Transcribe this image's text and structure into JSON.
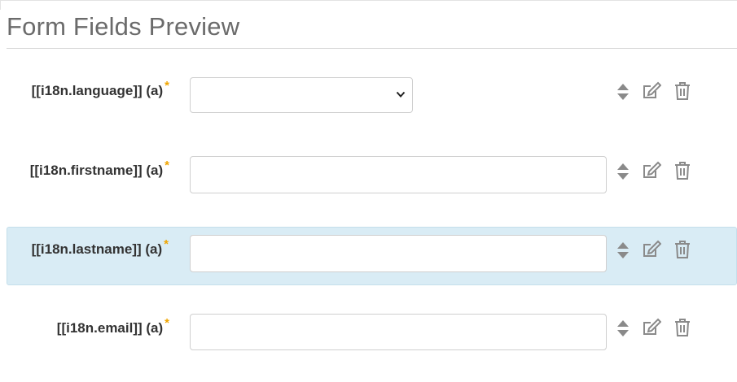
{
  "page": {
    "title": "Form Fields Preview"
  },
  "colors": {
    "required_marker": "#f0a500",
    "highlight_row": "#d9ecf5",
    "icon": "#8a8a8a"
  },
  "fields": [
    {
      "label": "[[i18n.language]] (a)",
      "required_marker": "*",
      "type": "select",
      "value": "",
      "icons": [
        "sort-icon",
        "edit-icon",
        "trash-icon"
      ]
    },
    {
      "label": "[[i18n.firstname]] (a)",
      "required_marker": "*",
      "type": "text",
      "value": "",
      "icons": [
        "sort-icon",
        "edit-icon",
        "trash-icon"
      ]
    },
    {
      "label": "[[i18n.lastname]] (a)",
      "required_marker": "*",
      "type": "text",
      "value": "",
      "selected": true,
      "icons": [
        "sort-icon",
        "edit-icon",
        "trash-icon"
      ]
    },
    {
      "label": "[[i18n.email]] (a)",
      "required_marker": "*",
      "type": "text",
      "value": "",
      "icons": [
        "sort-icon",
        "edit-icon",
        "trash-icon"
      ]
    }
  ]
}
